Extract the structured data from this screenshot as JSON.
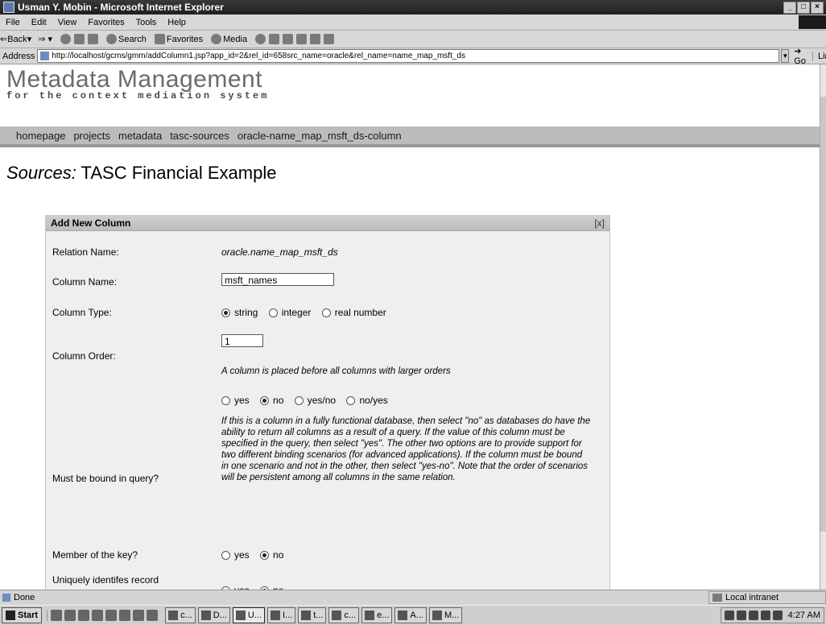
{
  "window": {
    "title": "Usman Y. Mobin - Microsoft Internet Explorer",
    "controls": [
      "_",
      "□",
      "×"
    ]
  },
  "menu": [
    "File",
    "Edit",
    "View",
    "Favorites",
    "Tools",
    "Help"
  ],
  "toolbar": {
    "back": "Back",
    "search": "Search",
    "favorites": "Favorites",
    "media": "Media"
  },
  "address": {
    "label": "Address",
    "url": "http://localhost/gcms/gmm/addColumn1.jsp?app_id=2&rel_id=658src_name=oracle&rel_name=name_map_msft_ds",
    "go": "Go",
    "links": "Links"
  },
  "page": {
    "brand_title": "Metadata Management",
    "brand_subtitle": "for the context mediation system",
    "nav": [
      "homepage",
      "projects",
      "metadata",
      "tasc-sources",
      "oracle-name_map_msft_ds-column"
    ],
    "heading_prefix": "Sources:",
    "heading_text": "TASC Financial Example"
  },
  "panel": {
    "title": "Add New Column",
    "close": "[x]",
    "relation_label": "Relation Name:",
    "relation_value": "oracle.name_map_msft_ds",
    "column_name_label": "Column Name:",
    "column_name_value": "msft_names",
    "column_type_label": "Column Type:",
    "column_type_options": [
      "string",
      "integer",
      "real number"
    ],
    "column_type_selected": "string",
    "column_order_label": "Column Order:",
    "column_order_value": "1",
    "column_order_help": "A column is placed before all columns with larger orders",
    "bound_label": "Must be bound in query?",
    "bound_options": [
      "yes",
      "no",
      "yes/no",
      "no/yes"
    ],
    "bound_selected": "no",
    "bound_help": "If this is a column in a fully functional database, then select \"no\" as databases do have the ability to return all columns as a result of a query. If the value of this column must be specified in the query, then select \"yes\". The other two options are to provide support for two different binding scenarios (for advanced applications). If the column must be bound in one scenario and not in the other, then select \"yes-no\". Note that the order of scenarios will be persistent among all columns in the same relation.",
    "key_label": "Member of the key?",
    "key_options": [
      "yes",
      "no"
    ],
    "key_selected": "no",
    "unique_label": "Uniquely identifes record",
    "unique_options": [
      "yes",
      "no"
    ],
    "unique_selected": "no"
  },
  "status": {
    "text": "Done",
    "zone": "Local intranet"
  },
  "taskbar": {
    "start": "Start",
    "tasks": [
      "c...",
      "D...",
      "U...",
      "I...",
      "t...",
      "c...",
      "e...",
      "A...",
      "M..."
    ],
    "active_task": 2,
    "clock": "4:27 AM"
  }
}
